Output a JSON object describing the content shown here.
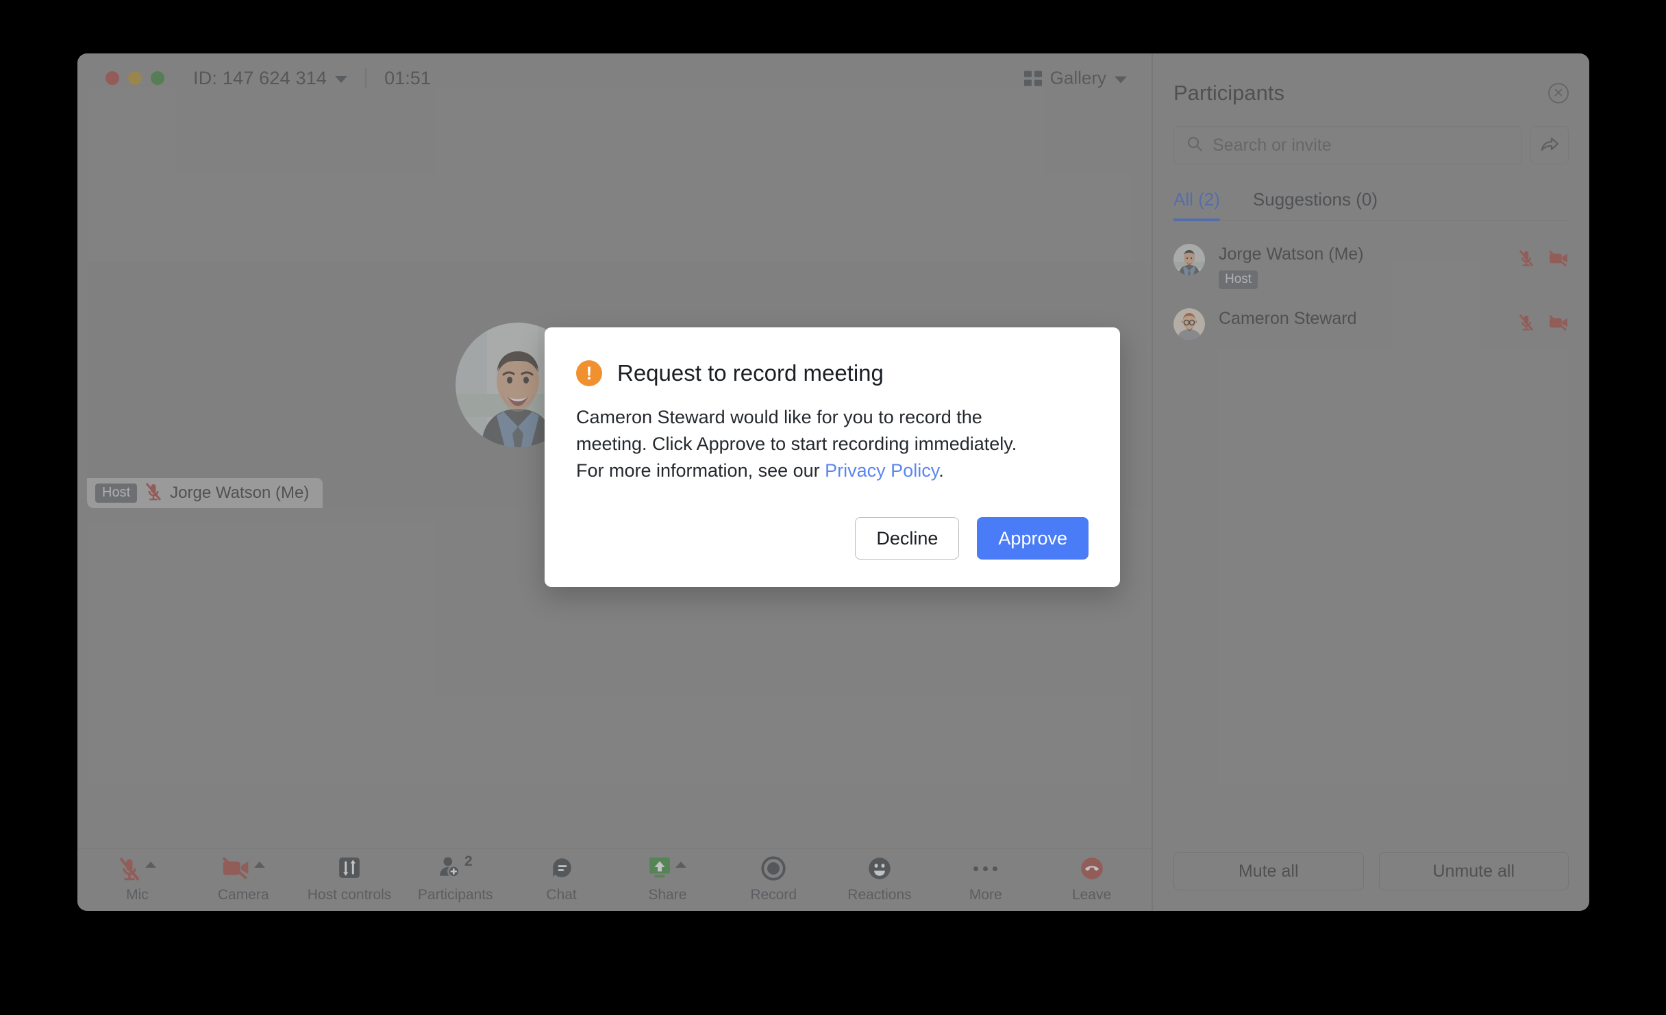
{
  "window": {
    "traffic_lights": [
      "close",
      "minimize",
      "maximize"
    ],
    "meeting_id": "ID: 147 624 314",
    "timer": "01:51",
    "view_mode": "Gallery"
  },
  "stage": {
    "tile": {
      "host_badge": "Host",
      "name": "Jorge Watson (Me)",
      "mic_state": "muted"
    }
  },
  "toolbar": [
    {
      "label": "Mic",
      "icon": "mic-off-icon",
      "state": "off",
      "caret": true
    },
    {
      "label": "Camera",
      "icon": "camera-off-icon",
      "state": "off",
      "caret": true
    },
    {
      "label": "Host controls",
      "icon": "sliders-icon",
      "state": "on",
      "caret": false
    },
    {
      "label": "Participants",
      "icon": "participants-icon",
      "badge": "2",
      "caret": false
    },
    {
      "label": "Chat",
      "icon": "chat-bubble-icon",
      "caret": false
    },
    {
      "label": "Share",
      "icon": "share-screen-icon",
      "caret": true
    },
    {
      "label": "Record",
      "icon": "record-icon",
      "caret": false
    },
    {
      "label": "Reactions",
      "icon": "smiley-icon",
      "caret": false
    },
    {
      "label": "More",
      "icon": "ellipsis-icon",
      "caret": false
    },
    {
      "label": "Leave",
      "icon": "leave-call-icon",
      "caret": false
    }
  ],
  "panel": {
    "title": "Participants",
    "close_icon": "close-circle-icon",
    "search": {
      "placeholder": "Search or invite",
      "value": "",
      "icon": "search-icon"
    },
    "invite_icon": "share-arrow-icon",
    "tabs": [
      {
        "label": "All (2)",
        "active": true
      },
      {
        "label": "Suggestions (0)",
        "active": false
      }
    ],
    "participants": [
      {
        "name": "Jorge Watson (Me)",
        "role_badge": "Host",
        "mic": "muted",
        "camera": "off"
      },
      {
        "name": "Cameron Steward",
        "role_badge": "",
        "mic": "muted",
        "camera": "off"
      }
    ],
    "footer": {
      "mute_all": "Mute all",
      "unmute_all": "Unmute all"
    }
  },
  "modal": {
    "icon": "warning-icon",
    "title": "Request to record meeting",
    "body_before_link": "Cameron Steward would like for you to record the meeting. Click Approve to start recording immediately. For more information, see our ",
    "link_text": "Privacy Policy",
    "body_after_link": ".",
    "decline_label": "Decline",
    "approve_label": "Approve"
  },
  "colors": {
    "accent_blue": "#4a7cf7",
    "link_blue": "#5b86f0",
    "tab_blue": "#2f5fd0",
    "warning_orange": "#f0902f",
    "danger_red": "#a33c36",
    "share_green": "#2f8a31",
    "window_bg": "#838383",
    "page_bg": "#000000"
  }
}
